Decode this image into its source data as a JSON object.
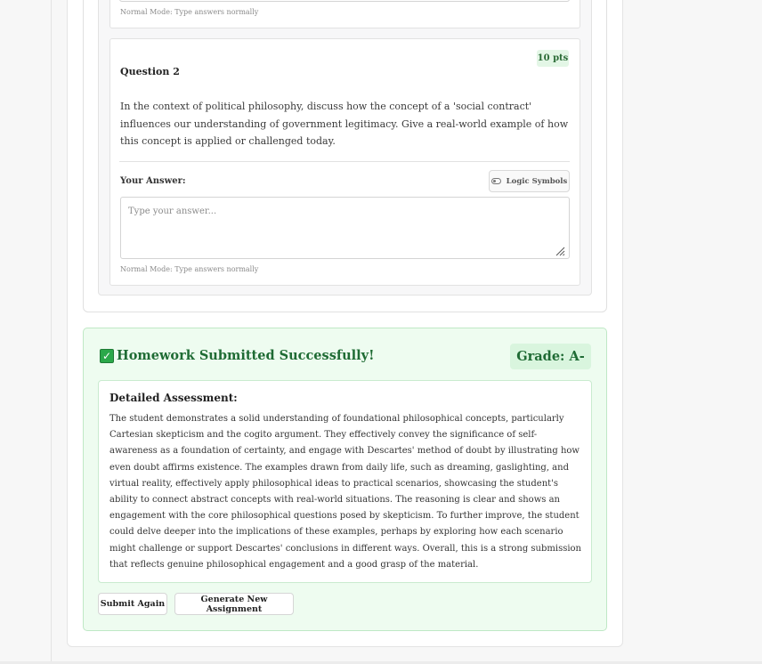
{
  "question1": {
    "mode_note": "Normal Mode: Type answers normally"
  },
  "question2": {
    "points": "10 pts",
    "title": "Question 2",
    "text": "In the context of political philosophy, discuss how the concept of a 'social contract' influences our understanding of government legitimacy. Give a real-world example of how this concept is applied or challenged today.",
    "answer_label": "Your Answer:",
    "logic_symbols_label": "Logic Symbols",
    "answer_placeholder": "Type your answer...",
    "mode_note": "Normal Mode: Type answers normally"
  },
  "result": {
    "title": "Homework Submitted Successfully!",
    "grade": "Grade: A-",
    "assessment_title": "Detailed Assessment:",
    "assessment_text": "The student demonstrates a solid understanding of foundational philosophical concepts, particularly Cartesian skepticism and the cogito argument. They effectively convey the significance of self-awareness as a foundation of certainty, and engage with Descartes' method of doubt by illustrating how even doubt affirms existence. The examples drawn from daily life, such as dreaming, gaslighting, and virtual reality, effectively apply philosophical ideas to practical scenarios, showcasing the student's ability to connect abstract concepts with real-world situations. The reasoning is clear and shows an engagement with the core philosophical questions posed by skepticism. To further improve, the student could delve deeper into the implications of these examples, perhaps by exploring how each scenario might challenge or support Descartes' conclusions in different ways. Overall, this is a strong submission that reflects genuine philosophical engagement and a good grasp of the material.",
    "check_icon": "check-square-icon"
  },
  "actions": {
    "submit_again": "Submit Again",
    "generate_new": "Generate New Assignment"
  },
  "colors": {
    "success_bg": "#eefcf0",
    "success_text": "#1f6b34",
    "check_green": "#2ba84a",
    "points_badge_bg": "#e3f6e6"
  }
}
